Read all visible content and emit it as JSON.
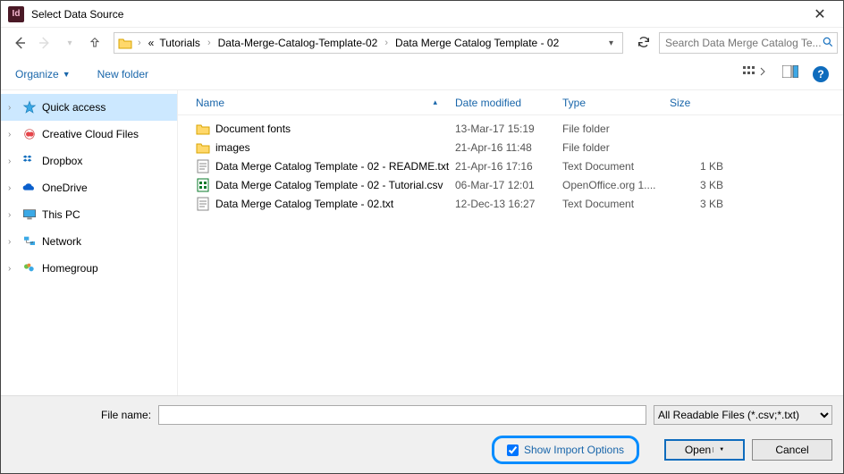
{
  "titlebar": {
    "title": "Select Data Source"
  },
  "nav": {
    "breadcrumb_prefix": "«",
    "crumbs": [
      "Tutorials",
      "Data-Merge-Catalog-Template-02",
      "Data Merge Catalog Template - 02"
    ],
    "search_placeholder": "Search Data Merge Catalog Te..."
  },
  "toolbar": {
    "organize": "Organize",
    "newfolder": "New folder"
  },
  "sidebar": {
    "items": [
      {
        "label": "Quick access",
        "icon": "star-icon",
        "selected": true
      },
      {
        "label": "Creative Cloud Files",
        "icon": "cc-icon",
        "selected": false
      },
      {
        "label": "Dropbox",
        "icon": "dropbox-icon",
        "selected": false
      },
      {
        "label": "OneDrive",
        "icon": "onedrive-icon",
        "selected": false
      },
      {
        "label": "This PC",
        "icon": "pc-icon",
        "selected": false
      },
      {
        "label": "Network",
        "icon": "network-icon",
        "selected": false
      },
      {
        "label": "Homegroup",
        "icon": "homegroup-icon",
        "selected": false
      }
    ]
  },
  "columns": {
    "name": "Name",
    "date": "Date modified",
    "type": "Type",
    "size": "Size"
  },
  "files": [
    {
      "icon": "folder-icon",
      "name": "Document fonts",
      "date": "13-Mar-17 15:19",
      "type": "File folder",
      "size": ""
    },
    {
      "icon": "folder-icon",
      "name": "images",
      "date": "21-Apr-16 11:48",
      "type": "File folder",
      "size": ""
    },
    {
      "icon": "txt-icon",
      "name": "Data Merge Catalog Template - 02 - README.txt",
      "date": "21-Apr-16 17:16",
      "type": "Text Document",
      "size": "1 KB"
    },
    {
      "icon": "csv-icon",
      "name": "Data Merge Catalog Template - 02 - Tutorial.csv",
      "date": "06-Mar-17 12:01",
      "type": "OpenOffice.org 1....",
      "size": "3 KB"
    },
    {
      "icon": "txt-icon",
      "name": "Data Merge Catalog Template - 02.txt",
      "date": "12-Dec-13 16:27",
      "type": "Text Document",
      "size": "3 KB"
    }
  ],
  "bottom": {
    "filename_label": "File name:",
    "filename_value": "",
    "filter": "All Readable Files (*.csv;*.txt)",
    "show_import": "Show Import Options",
    "open": "Open",
    "cancel": "Cancel"
  }
}
